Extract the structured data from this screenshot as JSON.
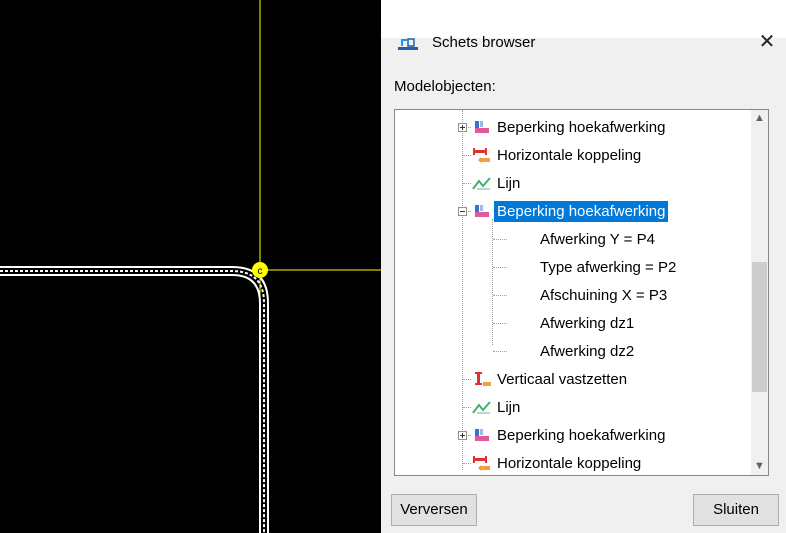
{
  "dialog": {
    "title": "Schets browser",
    "close_glyph": "✕",
    "models_label": "Modelobjecten:",
    "refresh_label": "Verversen",
    "close_label": "Sluiten"
  },
  "tree": {
    "items": [
      {
        "label": "Beperking hoekafwerking",
        "icon": "corner-constraint-icon",
        "expander": "plus"
      },
      {
        "label": "Horizontale koppeling",
        "icon": "horizontal-coupling-icon"
      },
      {
        "label": "Lijn",
        "icon": "line-icon"
      },
      {
        "label": "Beperking hoekafwerking",
        "icon": "corner-constraint-icon",
        "expander": "minus",
        "selected": true
      },
      {
        "label": "Afwerking Y = P4"
      },
      {
        "label": "Type afwerking = P2"
      },
      {
        "label": "Afschuining X = P3"
      },
      {
        "label": "Afwerking dz1"
      },
      {
        "label": "Afwerking dz2"
      },
      {
        "label": "Verticaal vastzetten",
        "icon": "vertical-fix-icon"
      },
      {
        "label": "Lijn",
        "icon": "line-icon"
      },
      {
        "label": "Beperking hoekafwerking",
        "icon": "corner-constraint-icon",
        "expander": "plus"
      },
      {
        "label": "Horizontale koppeling",
        "icon": "horizontal-coupling-icon"
      }
    ]
  },
  "colors": {
    "canvas_bg": "#000000",
    "crosshair": "#ffff00",
    "selection": "#0078d7"
  }
}
